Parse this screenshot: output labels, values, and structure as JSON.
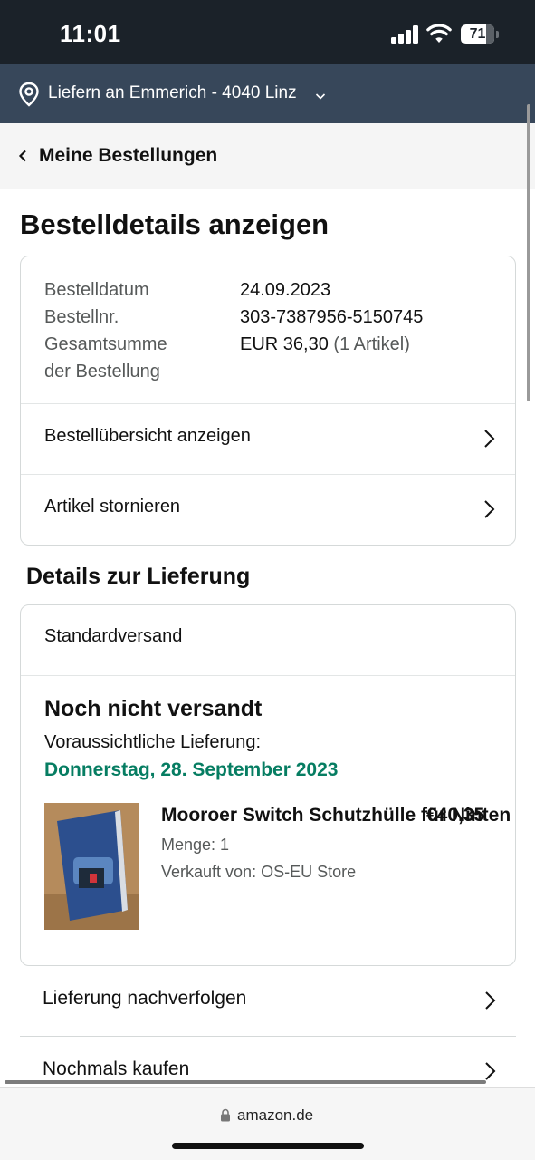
{
  "status_bar": {
    "time": "11:01",
    "battery": "71"
  },
  "delivery_location": {
    "text": "Liefern an Emmerich - 4040 Linz"
  },
  "nav": {
    "back_label": "Meine Bestellungen"
  },
  "page_title": "Bestelldetails anzeigen",
  "order_summary": {
    "date_label": "Bestelldatum",
    "date_value": "24.09.2023",
    "number_label": "Bestellnr.",
    "number_value": "303-7387956-5150745",
    "total_label_line1": "Gesamtsumme",
    "total_label_line2": "der Bestellung",
    "total_value": "EUR 36,30",
    "total_items": "(1 Artikel)"
  },
  "order_links": {
    "overview": "Bestellübersicht anzeigen",
    "cancel": "Artikel stornieren"
  },
  "delivery_section": {
    "title": "Details zur Lieferung",
    "shipping_method": "Standardversand",
    "status": "Noch nicht versandt",
    "eta_label": "Voraussichtliche Lieferung:",
    "eta_date": "Donnerstag, 28. September 2023",
    "product": {
      "title": "Mooroer Switch Schutzhülle für Ninten",
      "price": "€40,35",
      "quantity": "Menge: 1",
      "seller": "Verkauft von: OS-EU Store"
    }
  },
  "actions": {
    "track": "Lieferung nachverfolgen",
    "buy_again": "Nochmals kaufen"
  },
  "browser": {
    "url": "amazon.de"
  },
  "colors": {
    "header_dark": "#1b2229",
    "delivery_bar": "#37475a",
    "eta_green": "#067d62"
  },
  "icons": [
    "location-pin-icon",
    "chevron-down-icon",
    "chevron-left-icon",
    "chevron-right-icon",
    "lock-icon",
    "signal-icon",
    "wifi-icon",
    "battery-icon"
  ]
}
